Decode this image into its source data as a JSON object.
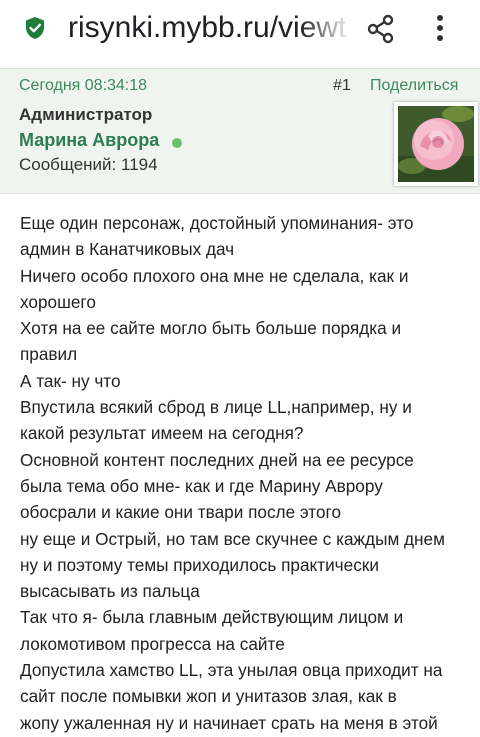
{
  "browser": {
    "url": "risynki.mybb.ru/viewt",
    "icons": [
      "shield-check-icon",
      "share-icon",
      "more-vert-icon"
    ]
  },
  "post": {
    "date": "Сегодня 08:34:18",
    "number": "#1",
    "share_label": "Поделиться",
    "role": "Администратор",
    "username": "Марина Аврора",
    "posts_label": "Сообщений: 1194",
    "online_color": "#6cc16c",
    "accent_color": "#2e7d52",
    "body_lines": [
      "Еще один персонаж, достойный упоминания- это",
      "админ в Канатчиковых дач",
      "Ничего особо плохого она мне не сделала, как и",
      "хорошего",
      "Хотя на ее сайте могло быть больше порядка и",
      "правил",
      "А так- ну что",
      "Впустила всякий сброд в лице LL,например, ну и",
      "какой результат имеем на сегодня?",
      "Основной контент последних дней на ее ресурсе",
      "была тема обо мне- как и где Марину Аврору",
      "обосрали и какие они твари после этого",
      "ну еще и Острый, но там все скучнее с каждым днем",
      "ну и поэтому темы приходилось практически",
      "высасывать из пальца",
      "Так что я- была главным действующим лицом и",
      "локомотивом прогресса на сайте",
      "Допустила хамство LL, эта унылая овца приходит на",
      "сайт после  помывки жоп и унитазов злая, как в",
      "жопу ужаленная ну и начинает срать на меня в этой"
    ]
  }
}
